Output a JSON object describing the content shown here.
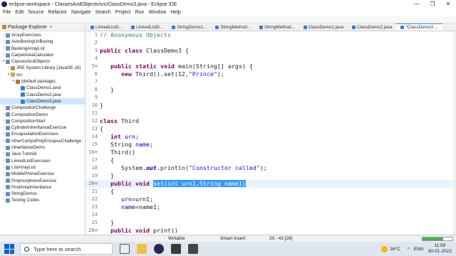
{
  "window": {
    "title": "eclipse-workspace - ClassesAndObjects/src/ClassDemo3.java - Eclipse IDE",
    "controls": [
      "—",
      "❐",
      "✕"
    ]
  },
  "menu": [
    "File",
    "Edit",
    "Source",
    "Refactor",
    "Navigate",
    "Search",
    "Project",
    "Run",
    "Window",
    "Help"
  ],
  "package_explorer": {
    "title": "Package Explorer",
    "items": [
      {
        "label": "ArrayExercises",
        "depth": 0,
        "icon": "project-icon",
        "expanded": false
      },
      {
        "label": "AutoBoxingUnBoxing",
        "depth": 0,
        "icon": "project-icon",
        "expanded": false
      },
      {
        "label": "BankingArrayList",
        "depth": 0,
        "icon": "project-icon",
        "expanded": false
      },
      {
        "label": "CarpetAreaCalculator",
        "depth": 0,
        "icon": "project-icon",
        "expanded": false
      },
      {
        "label": "ClassesAndObjects",
        "depth": 0,
        "icon": "project-icon",
        "expanded": true
      },
      {
        "label": "JRE System Library [JavaSE-16]",
        "depth": 1,
        "icon": "library-icon",
        "expanded": false
      },
      {
        "label": "src",
        "depth": 1,
        "icon": "source-folder-icon",
        "expanded": true
      },
      {
        "label": "(default package)",
        "depth": 2,
        "icon": "package-icon",
        "expanded": true
      },
      {
        "label": "ClassDemo1.java",
        "depth": 3,
        "icon": "java-file-icon",
        "expanded": false
      },
      {
        "label": "ClassDemo2.java",
        "depth": 3,
        "icon": "java-file-icon",
        "expanded": false
      },
      {
        "label": "ClassDemo3.java",
        "depth": 3,
        "icon": "java-file-icon",
        "expanded": false,
        "selected": true
      },
      {
        "label": "CompositionChallenge",
        "depth": 0,
        "icon": "project-icon",
        "expanded": false
      },
      {
        "label": "CompositionDemo",
        "depth": 0,
        "icon": "project-icon",
        "expanded": false
      },
      {
        "label": "CompositionStart",
        "depth": 0,
        "icon": "project-icon",
        "expanded": false
      },
      {
        "label": "CylinderInheritanceExercise",
        "depth": 0,
        "icon": "project-icon",
        "expanded": false
      },
      {
        "label": "EncapsulationExercises",
        "depth": 0,
        "icon": "project-icon",
        "expanded": false
      },
      {
        "label": "InherCompoPolyEncapsuChallenge",
        "depth": 0,
        "icon": "project-icon",
        "expanded": false
      },
      {
        "label": "InheritanceDemo",
        "depth": 0,
        "icon": "project-icon",
        "expanded": false
      },
      {
        "label": "Java Tutorial",
        "depth": 0,
        "icon": "project-icon",
        "expanded": false
      },
      {
        "label": "LinkedListExercises",
        "depth": 0,
        "icon": "project-icon",
        "expanded": false
      },
      {
        "label": "ListArrayList",
        "depth": 0,
        "icon": "project-icon",
        "expanded": false
      },
      {
        "label": "MobilePhoneExercise",
        "depth": 0,
        "icon": "project-icon",
        "expanded": false
      },
      {
        "label": "PolymorphismExercise",
        "depth": 0,
        "icon": "project-icon",
        "expanded": false
      },
      {
        "label": "PoolAreaInheritance",
        "depth": 0,
        "icon": "project-icon",
        "expanded": false
      },
      {
        "label": "StringDemos",
        "depth": 0,
        "icon": "project-icon",
        "expanded": false
      },
      {
        "label": "Testing Codes",
        "depth": 0,
        "icon": "project-icon",
        "expanded": false
      }
    ]
  },
  "tabs": [
    {
      "label": "LinkedListD...",
      "active": false
    },
    {
      "label": "LinkedListD...",
      "active": false
    },
    {
      "label": "StringDemo1...",
      "active": false
    },
    {
      "label": "StringMethod...",
      "active": false
    },
    {
      "label": "StringMethod...",
      "active": false
    },
    {
      "label": "ClassDemo1.java",
      "active": false
    },
    {
      "label": "ClassDemo2.java",
      "active": false
    },
    {
      "label": "*ClassDemo3....",
      "active": true
    }
  ],
  "editor": {
    "lines": [
      {
        "n": "1",
        "tokens": [
          [
            "cm",
            "// Anonymous Objects"
          ]
        ]
      },
      {
        "n": "2",
        "tokens": []
      },
      {
        "n": "3",
        "tokens": [
          [
            "kw",
            "public"
          ],
          [
            "",
            " "
          ],
          [
            "kw",
            "class"
          ],
          [
            "",
            " ClassDemo3 {"
          ]
        ]
      },
      {
        "n": "4",
        "tokens": []
      },
      {
        "n": "5⊖",
        "tokens": [
          [
            "",
            "   "
          ],
          [
            "kw",
            "public"
          ],
          [
            "",
            " "
          ],
          [
            "kw",
            "static"
          ],
          [
            "",
            " "
          ],
          [
            "kw",
            "void"
          ],
          [
            "",
            " main(String[] args) {"
          ]
        ]
      },
      {
        "n": "6",
        "tokens": [
          [
            "",
            "      "
          ],
          [
            "kw",
            "new"
          ],
          [
            "",
            " Third().set(12,"
          ],
          [
            "st",
            "\"Prince\""
          ],
          [
            "",
            ");"
          ]
        ]
      },
      {
        "n": "7",
        "tokens": []
      },
      {
        "n": "8",
        "tokens": [
          [
            "",
            "   }"
          ]
        ]
      },
      {
        "n": "9",
        "tokens": []
      },
      {
        "n": "10",
        "tokens": [
          [
            "",
            "}"
          ]
        ]
      },
      {
        "n": "11",
        "tokens": []
      },
      {
        "n": "12",
        "tokens": [
          [
            "kw",
            "class"
          ],
          [
            "",
            " Third"
          ]
        ]
      },
      {
        "n": "13",
        "tokens": [
          [
            "",
            "{"
          ]
        ]
      },
      {
        "n": "14",
        "tokens": [
          [
            "",
            "   "
          ],
          [
            "kw",
            "int"
          ],
          [
            "",
            " "
          ],
          [
            "fld",
            "urn"
          ],
          [
            "",
            ";"
          ]
        ]
      },
      {
        "n": "15",
        "tokens": [
          [
            "",
            "   String "
          ],
          [
            "fld",
            "name"
          ],
          [
            "",
            ";"
          ]
        ]
      },
      {
        "n": "16⊖",
        "tokens": [
          [
            "",
            "   Third()"
          ]
        ]
      },
      {
        "n": "17",
        "tokens": [
          [
            "",
            "   {"
          ]
        ]
      },
      {
        "n": "18",
        "tokens": [
          [
            "",
            "      System."
          ],
          [
            "sf",
            "out"
          ],
          [
            "",
            ".println("
          ],
          [
            "st",
            "\"Constructor called\""
          ],
          [
            "",
            ");"
          ]
        ]
      },
      {
        "n": "19",
        "tokens": [
          [
            "",
            "   }"
          ]
        ]
      },
      {
        "n": "20⊖",
        "current": true,
        "tokens": [
          [
            "",
            "   "
          ],
          [
            "kw",
            "public"
          ],
          [
            "",
            " "
          ],
          [
            "kw",
            "void"
          ],
          [
            "",
            " "
          ],
          [
            "hl",
            "set(int urn1,String name1)"
          ]
        ]
      },
      {
        "n": "21",
        "tokens": [
          [
            "",
            "   {"
          ]
        ]
      },
      {
        "n": "22",
        "tokens": [
          [
            "",
            "      "
          ],
          [
            "fld",
            "urn"
          ],
          [
            "",
            "=urn1;"
          ]
        ]
      },
      {
        "n": "23",
        "tokens": [
          [
            "",
            "      "
          ],
          [
            "fld",
            "name"
          ],
          [
            "",
            "=name1;"
          ]
        ]
      },
      {
        "n": "24",
        "tokens": []
      },
      {
        "n": "25",
        "tokens": [
          [
            "",
            "   }"
          ]
        ]
      },
      {
        "n": "26⊖",
        "tokens": [
          [
            "",
            "   "
          ],
          [
            "kw",
            "public"
          ],
          [
            "",
            " "
          ],
          [
            "kw",
            "void"
          ],
          [
            "",
            " print()"
          ]
        ]
      }
    ]
  },
  "status": {
    "mode": "Writable",
    "insert": "Smart Insert",
    "position": "20 : 43 [26]",
    "progress": 0.7
  },
  "taskbar": {
    "search_placeholder": "Type here to search",
    "temperature": "16°C",
    "language": "ENG",
    "time": "11:59",
    "date": "30-01-2022"
  }
}
